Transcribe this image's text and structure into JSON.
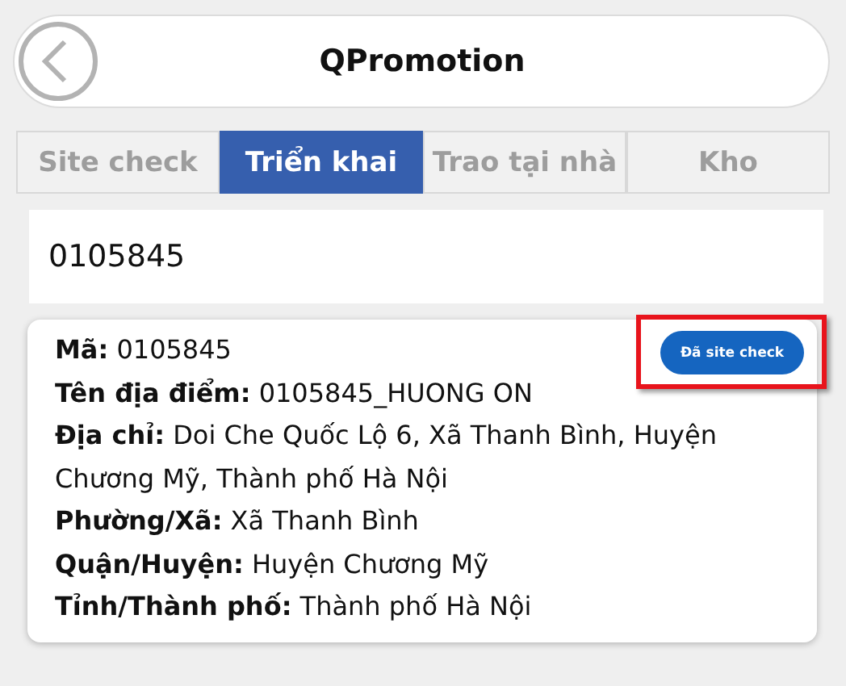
{
  "header": {
    "title": "QPromotion"
  },
  "tabs": [
    {
      "label": "Site check",
      "selected": false
    },
    {
      "label": "Triển khai",
      "selected": true
    },
    {
      "label": "Trao tại nhà",
      "selected": false
    },
    {
      "label": "Kho",
      "selected": false
    }
  ],
  "search": {
    "value": "0105845"
  },
  "card": {
    "status_button": {
      "label": "Đã site check",
      "highlighted": true
    },
    "fields": [
      {
        "label": "Mã:",
        "value": "0105845"
      },
      {
        "label": "Tên địa điểm:",
        "value": "0105845_HUONG ON"
      },
      {
        "label": "Địa chỉ:",
        "value": "Doi Che Quốc Lộ 6, Xã Thanh Bình, Huyện Chương Mỹ, Thành phố Hà Nội"
      },
      {
        "label": "Phường/Xã:",
        "value": "Xã Thanh Bình"
      },
      {
        "label": "Quận/Huyện:",
        "value": "Huyện Chương Mỹ"
      },
      {
        "label": "Tỉnh/Thành phố:",
        "value": "Thành phố Hà Nội"
      }
    ]
  }
}
